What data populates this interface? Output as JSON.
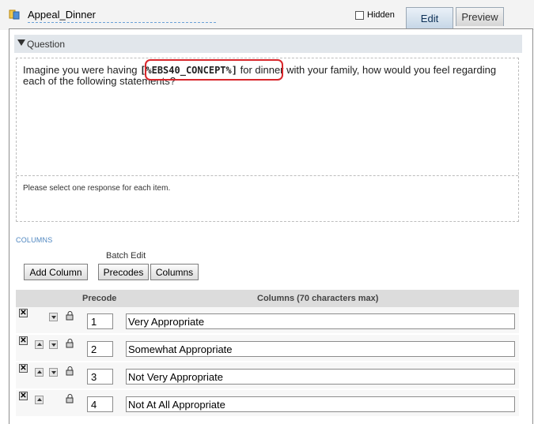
{
  "header": {
    "question_name": "Appeal_Dinner",
    "hidden_label": "Hidden",
    "tabs": [
      {
        "label": "Edit",
        "active": true
      },
      {
        "label": "Preview",
        "active": false
      }
    ]
  },
  "question_section": {
    "label": "Question",
    "text_before": "Imagine you were having ",
    "concept": "[%EBS40_CONCEPT%]",
    "text_after": " for dinner with your family, how would you feel regarding each of the following statements?",
    "instructions": "Please select one response for each item."
  },
  "columns_section": {
    "label": "COLUMNS",
    "batch_edit_label": "Batch Edit",
    "add_column_label": "Add Column",
    "precodes_label": "Precodes",
    "columns_label": "Columns",
    "table_headers": {
      "precode": "Precode",
      "columns": "Columns (70 characters max)"
    },
    "rows": [
      {
        "precode": "1",
        "text": "Very Appropriate",
        "has_up": false,
        "has_down": true
      },
      {
        "precode": "2",
        "text": "Somewhat Appropriate",
        "has_up": true,
        "has_down": true
      },
      {
        "precode": "3",
        "text": "Not Very Appropriate",
        "has_up": true,
        "has_down": true
      },
      {
        "precode": "4",
        "text": "Not At All Appropriate",
        "has_up": true,
        "has_down": false
      }
    ]
  },
  "colors": {
    "highlight": "#d8262b",
    "link_blue": "#4e86c0",
    "header_bg": "#e1e6eb"
  }
}
